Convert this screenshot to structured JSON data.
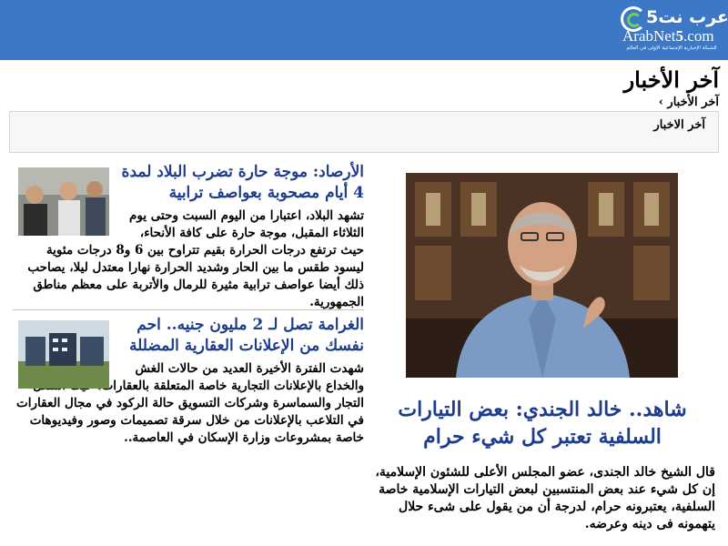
{
  "header": {
    "logo_arabic": "عرب نت5",
    "logo_latin_prefix": "ArabNet",
    "logo_latin_number": "5",
    "logo_latin_suffix": ".com",
    "logo_tagline": "الشبكة الإخبارية الإجتماعية الأولى في العالم",
    "brand_color": "#3c78c6"
  },
  "page": {
    "title": "آخر الأخبار",
    "breadcrumb": "آخر الأخبار ›",
    "section_label": "آخر الاخبار"
  },
  "featured": {
    "title": "شاهد.. خالد الجندي: بعض التيارات السلفية تعتبر كل شيء حرام",
    "summary": "قال الشيخ خالد الجندى، عضو المجلس الأعلى للشئون الإسلامية، إن كل شيء عند بعض المنتسبين لبعض التيارات الإسلامية خاصة السلفية، يعتبرونه حرام، لدرجة أن من يقول على شىء حلال يتهمونه فى دينه وعرضه."
  },
  "news": [
    {
      "title": "الأرصاد: موجة حارة تضرب البلاد لمدة 4 أيام مصحوبة بعواصف ترابية",
      "body": "تشهد البلاد، اعتبارا من اليوم السبت وحتى يوم الثلاثاء المقبل، موجة حارة على كافة الأنحاء، حيث ترتفع درجات الحرارة بقيم تتراوح بين 6 و8 درجات مئوية ليسود طقس ما بين الحار وشديد الحرارة نهارا معتدل ليلا، يصاحب ذلك أيضا عواصف ترابية مثيرة للرمال والأتربة على معظم مناطق الجمهورية."
    },
    {
      "title": "الغرامة تصل لـ 2 مليون جنيه.. احم نفسك من الإعلانات العقارية المضللة",
      "body": "شهدت الفترة الأخيرة العديد من حالات الغش والخداع بالإعلانات التجارية خاصة المتعلقة بالعقارات، حيث استغل التجار والسماسرة وشركات التسويق حالة الركود في مجال العقارات في التلاعب بالإعلانات من خلال سرقة تصميمات وصور وفيديوهات خاصة بمشروعات وزارة الإسكان في العاصمة.."
    }
  ]
}
